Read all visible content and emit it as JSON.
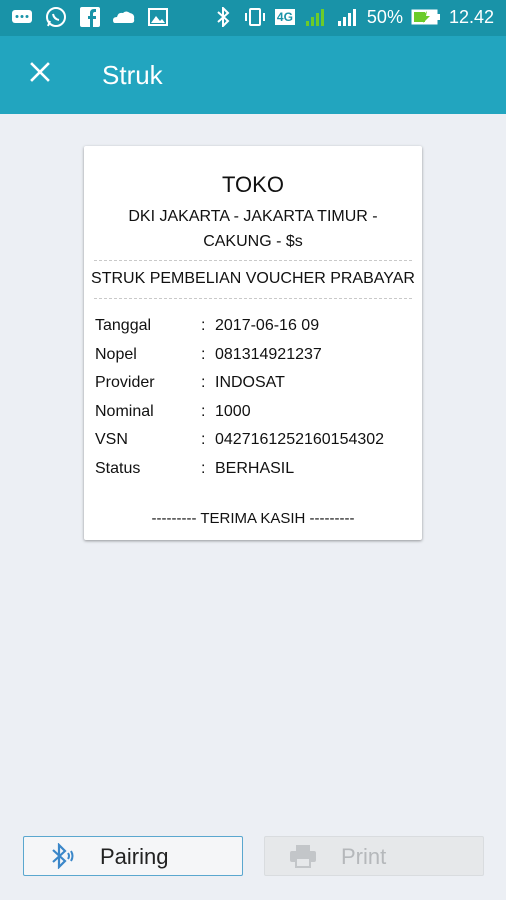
{
  "status_bar": {
    "battery": "50%",
    "time": "12.42",
    "network": "4G"
  },
  "app_bar": {
    "title": "Struk",
    "close_icon": "close-icon"
  },
  "receipt": {
    "store_name": "TOKO",
    "address": "DKI JAKARTA - JAKARTA TIMUR - CAKUNG - $s",
    "title": "STRUK PEMBELIAN VOUCHER PRABAYAR",
    "rows": [
      {
        "label": "Tanggal",
        "value": "2017-06-16 09"
      },
      {
        "label": "Nopel",
        "value": "081314921237"
      },
      {
        "label": "Provider",
        "value": "INDOSAT"
      },
      {
        "label": "Nominal",
        "value": "1000"
      },
      {
        "label": "VSN",
        "value": "0427161252160154302"
      },
      {
        "label": "Status",
        "value": "BERHASIL"
      }
    ],
    "separator": ":",
    "footer": "--------- TERIMA KASIH ---------"
  },
  "buttons": {
    "pairing_label": "Pairing",
    "print_label": "Print"
  },
  "colors": {
    "status_bar": "#1993a8",
    "app_bar": "#22a5bf",
    "background": "#eceff4",
    "battery_charge": "#6ccb2a"
  }
}
